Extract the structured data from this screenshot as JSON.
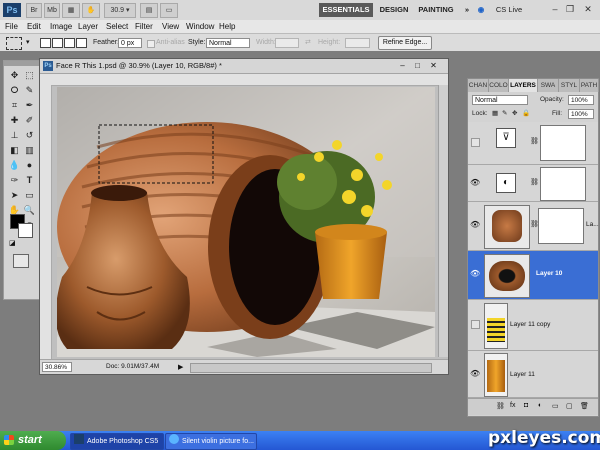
{
  "app": {
    "logo": "Ps",
    "zoom_value": "30.9",
    "workspaces": [
      "ESSENTIALS",
      "DESIGN",
      "PAINTING"
    ],
    "more": "»",
    "cs_live": "CS Live"
  },
  "menu": [
    "File",
    "Edit",
    "Image",
    "Layer",
    "Select",
    "Filter",
    "View",
    "Window",
    "Help"
  ],
  "options": {
    "feather_label": "Feather:",
    "feather_value": "0 px",
    "antialias_label": "Anti-alias",
    "style_label": "Style:",
    "style_value": "Normal",
    "width_label": "Width:",
    "height_label": "Height:",
    "refine_edge": "Refine Edge..."
  },
  "document": {
    "title": "Face R This 1.psd @ 30.9% (Layer 10, RGB/8#) *",
    "zoom": "30.86%",
    "doc_info": "Doc: 9.01M/37.4M"
  },
  "layers_panel": {
    "tabs": [
      "CHAN",
      "COLO",
      "LAYERS",
      "SWA",
      "STYL",
      "PATH"
    ],
    "blend_mode": "Normal",
    "opacity_label": "Opacity:",
    "opacity_value": "100%",
    "lock_label": "Lock:",
    "fill_label": "Fill:",
    "fill_value": "100%",
    "layers": [
      {
        "name": "",
        "visible": false,
        "selected": false
      },
      {
        "name": "",
        "visible": true,
        "selected": false
      },
      {
        "name": "La...",
        "visible": true,
        "selected": false
      },
      {
        "name": "Layer 10",
        "visible": true,
        "selected": true
      },
      {
        "name": "Layer 11 copy",
        "visible": false,
        "selected": false
      },
      {
        "name": "Layer 11",
        "visible": true,
        "selected": false
      }
    ]
  },
  "taskbar": {
    "start": "start",
    "items": [
      "Adobe Photoshop CS5",
      "Silent violin picture fo..."
    ]
  },
  "watermark": "pxleyes.com"
}
